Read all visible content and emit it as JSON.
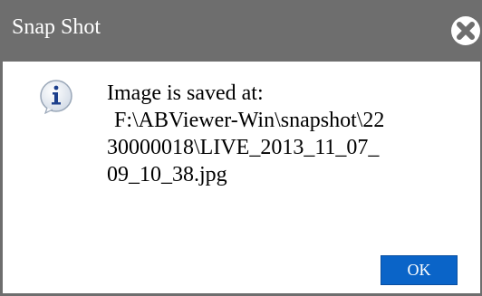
{
  "window": {
    "title": "Snap Shot",
    "close_icon": "close-circle-x-icon"
  },
  "message": {
    "icon": "info-icon",
    "heading": "Image is saved at:",
    "path_lines": [
      "F:\\ABViewer-Win\\snapshot\\22",
      "30000018\\LIVE_2013_11_07_",
      "09_10_38.jpg"
    ]
  },
  "buttons": {
    "ok_label": "OK"
  },
  "colors": {
    "titlebar": "#6e6e6e",
    "button_accent": "#0a64c8"
  }
}
